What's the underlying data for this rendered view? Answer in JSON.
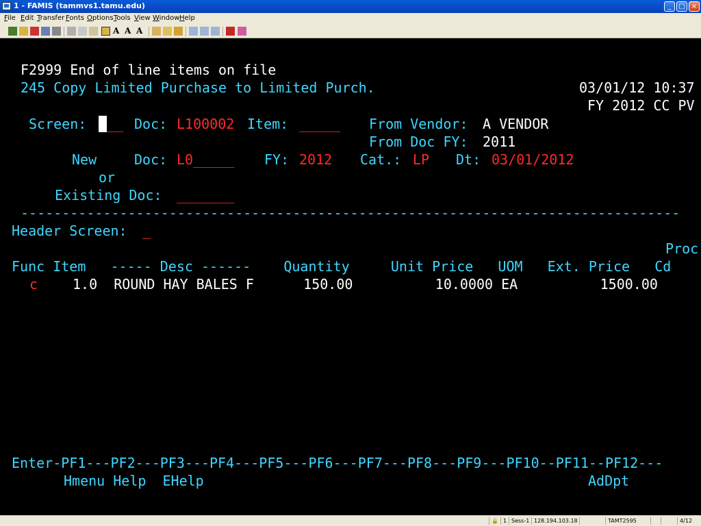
{
  "window": {
    "title": "1 - FAMIS (tammvs1.tamu.edu)",
    "buttons": {
      "minimize": "_",
      "maximize": "□",
      "close": "×"
    }
  },
  "menu": [
    "File",
    "Edit",
    "Transfer",
    "Fonts",
    "Options",
    "Tools",
    "View",
    "Window",
    "Help"
  ],
  "toolbar": {
    "icons": [
      "connect-icon",
      "disconnect-icon",
      "new-session-icon",
      "properties-icon",
      "print-icon",
      "cut-icon",
      "copy-icon",
      "paste-icon",
      "active-tool-icon",
      "font-a-icon",
      "font-smaller-icon",
      "font-larger-icon",
      "send-file-icon",
      "receive-file-icon",
      "macro-icon",
      "pa1-icon",
      "pa2-icon",
      "pa3-icon",
      "enter-icon",
      "erase-icon"
    ],
    "labels": {
      "font_a": "A",
      "font_smaller": "A",
      "font_larger": "A"
    }
  },
  "terminal": {
    "message1": "F2999 End of line items on file",
    "screen_title": "245 Copy Limited Purchase to Limited Purch.",
    "datetime": "03/01/12 10:37",
    "fy_label": "FY 2012 CC PV",
    "screen_label": "Screen:",
    "screen_value": " ",
    "screen_underline": "__",
    "doc_label": "Doc:",
    "doc_value": "L100002",
    "item_label": "Item:",
    "item_value": "_____",
    "from_vendor_label": "From Vendor:",
    "from_vendor_value": "A VENDOR",
    "from_docfy_label": "From Doc FY:",
    "from_docfy_value": "2011",
    "new_label": "New",
    "new_doc_label": "Doc:",
    "new_doc_value": "L0_____",
    "fy2_label": "FY:",
    "fy2_value": "2012",
    "cat_label": "Cat.:",
    "cat_value": "LP",
    "dt_label": "Dt:",
    "dt_value": "03/01/2012",
    "or_label": "or",
    "existing_doc_label": "Existing Doc:",
    "existing_doc_value": "_______",
    "separator": "--------------------------------------------------------------------------------",
    "header_screen_label": "Header Screen:",
    "header_screen_value": "_",
    "proc_label": "Proc",
    "col_headers": "Func Item   ----- Desc ------    Quantity     Unit Price   UOM   Ext. Price   Cd",
    "row": {
      "func": "c",
      "rest": "1.0  ROUND HAY BALES F      150.00          10.0000 EA          1500.00"
    },
    "pf_keys": "Enter-PF1---PF2---PF3---PF4---PF5---PF6---PF7---PF8---PF9---PF10--PF11--PF12---",
    "pf_labels1": "Hmenu Help  EHelp",
    "pf_labels2": "AdDpt"
  },
  "status": {
    "lock_indicator": "1",
    "session": "Sess-1",
    "host": "128.194.103.18",
    "terminal_id": "TAMT2595",
    "cursor_pos": "4/12"
  }
}
